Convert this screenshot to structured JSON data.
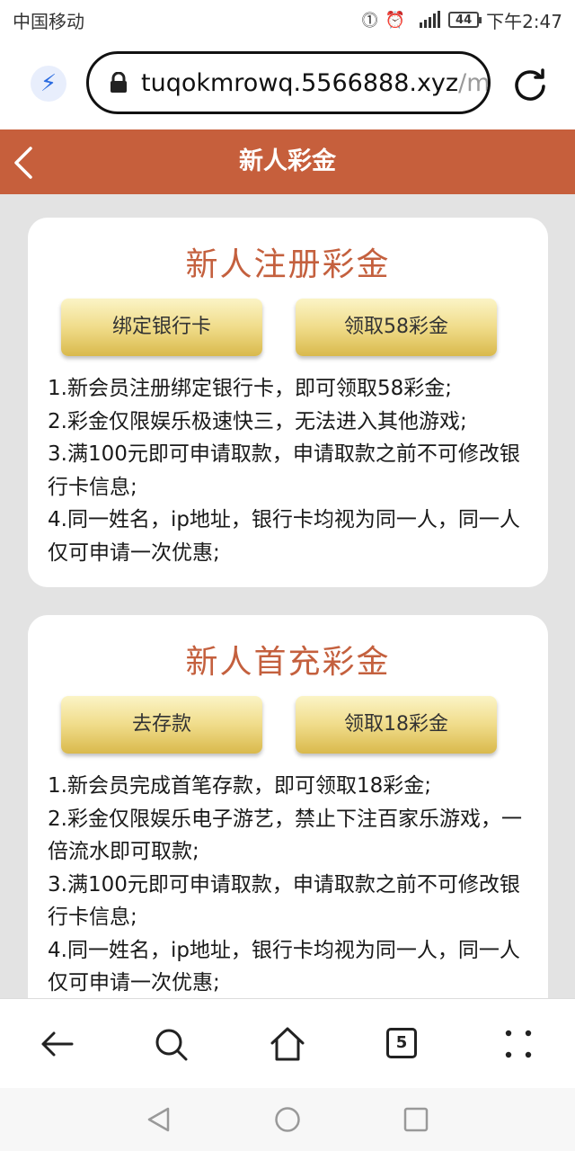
{
  "status": {
    "carrier": "中国移动",
    "battery": "44",
    "time": "下午2:47"
  },
  "browser": {
    "url_main": "tuqokmrowq.5566888.xyz",
    "url_dim": "/m/",
    "tab_count": "5"
  },
  "header": {
    "title": "新人彩金"
  },
  "cards": [
    {
      "title": "新人注册彩金",
      "left_button": "绑定银行卡",
      "right_button": "领取58彩金",
      "rules": [
        "1.新会员注册绑定银行卡，即可领取58彩金;",
        "2.彩金仅限娱乐极速快三，无法进入其他游戏;",
        "3.满100元即可申请取款，申请取款之前不可修改银行卡信息;",
        "4.同一姓名，ip地址，银行卡均视为同一人，同一人仅可申请一次优惠;"
      ]
    },
    {
      "title": "新人首充彩金",
      "left_button": "去存款",
      "right_button": "领取18彩金",
      "rules": [
        "1.新会员完成首笔存款，即可领取18彩金;",
        "2.彩金仅限娱乐电子游艺，禁止下注百家乐游戏，一倍流水即可取款;",
        "3.满100元即可申请取款，申请取款之前不可修改银行卡信息;",
        "4.同一姓名，ip地址，银行卡均视为同一人，同一人仅可申请一次优惠;"
      ]
    }
  ]
}
